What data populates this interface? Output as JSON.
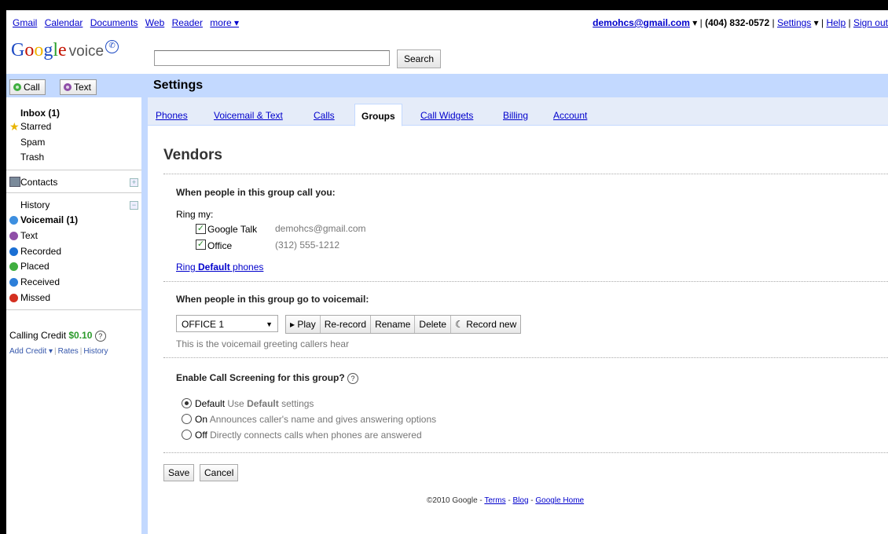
{
  "topbar": {
    "links": [
      "Gmail",
      "Calendar",
      "Documents",
      "Web",
      "Reader",
      "more ▾"
    ],
    "account": "demohcs@gmail.com",
    "account_caret": "▾",
    "phone": "(404) 832-0572",
    "settings": "Settings",
    "settings_caret": "▾",
    "help": "Help",
    "signout": "Sign out"
  },
  "logo": {
    "letters": [
      "G",
      "o",
      "o",
      "g",
      "l",
      "e"
    ],
    "product": "voice"
  },
  "search": {
    "value": "",
    "button": "Search"
  },
  "left_header": {
    "call": "Call",
    "text": "Text"
  },
  "sidebar": {
    "inbox": "Inbox (1)",
    "starred": "Starred",
    "spam": "Spam",
    "trash": "Trash",
    "contacts": "Contacts",
    "history": "History",
    "history_items": [
      {
        "label": "Voicemail (1)",
        "color": "#3d8fe0",
        "bold": true
      },
      {
        "label": "Text",
        "color": "#8f4fa8",
        "bold": false
      },
      {
        "label": "Recorded",
        "color": "#1a6fd4",
        "bold": false
      },
      {
        "label": "Placed",
        "color": "#3fae3f",
        "bold": false
      },
      {
        "label": "Received",
        "color": "#2d7fd9",
        "bold": false
      },
      {
        "label": "Missed",
        "color": "#d43020",
        "bold": false
      }
    ],
    "calling_credit_label": "Calling Credit",
    "calling_credit_amount": "$0.10",
    "credit_links": [
      "Add Credit ▾",
      "Rates",
      "History"
    ]
  },
  "page": {
    "header_title": "Settings",
    "tabs": [
      "Phones",
      "Voicemail & Text",
      "Calls",
      "Groups",
      "Call Widgets",
      "Billing",
      "Account"
    ],
    "active_tab": "Groups",
    "group_name": "Vendors"
  },
  "call_section": {
    "heading": "When people in this group call you:",
    "ring_label": "Ring my:",
    "phones": [
      {
        "name": "Google Talk",
        "detail": "demohcs@gmail.com",
        "checked": true
      },
      {
        "name": "Office",
        "detail": "(312) 555-1212",
        "checked": true
      }
    ],
    "ring_default_pre": "Ring ",
    "ring_default_bold": "Default",
    "ring_default_post": " phones"
  },
  "voicemail_section": {
    "heading": "When people in this group go to voicemail:",
    "selected_greeting": "OFFICE 1",
    "buttons": [
      "▸ Play",
      "Re-record",
      "Rename",
      "Delete",
      "☾ Record new"
    ],
    "hint": "This is the voicemail greeting callers hear"
  },
  "screening_section": {
    "heading": "Enable Call Screening for this group?",
    "options": [
      {
        "label": "Default",
        "desc_pre": "Use ",
        "desc_bold": "Default",
        "desc_post": " settings",
        "selected": true
      },
      {
        "label": "On",
        "desc_pre": "Announces caller's name and gives answering options",
        "desc_bold": "",
        "desc_post": "",
        "selected": false
      },
      {
        "label": "Off",
        "desc_pre": "Directly connects calls when phones are answered",
        "desc_bold": "",
        "desc_post": "",
        "selected": false
      }
    ]
  },
  "actions": {
    "save": "Save",
    "cancel": "Cancel"
  },
  "footer": {
    "copyright": "©2010 Google - ",
    "terms": "Terms",
    "blog": "Blog",
    "home": "Google Home",
    "dash": " - "
  }
}
